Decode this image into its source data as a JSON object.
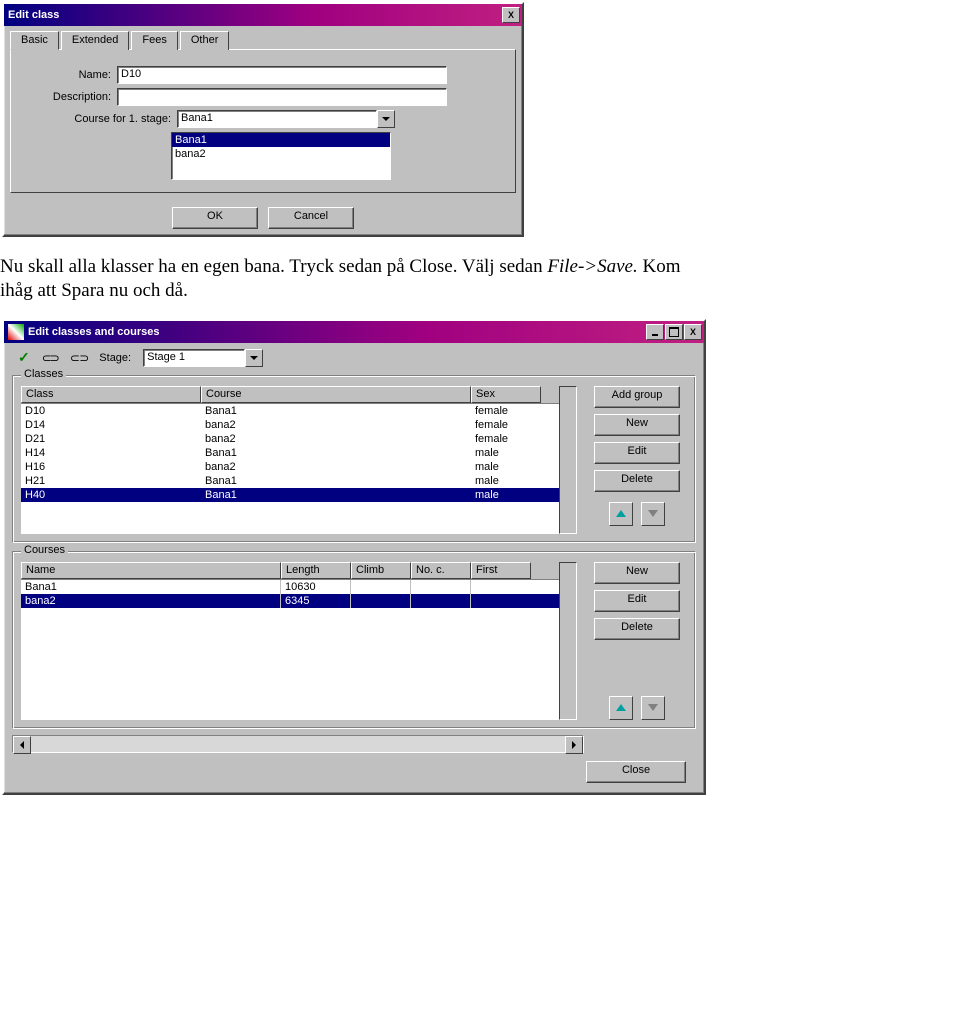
{
  "dialog1": {
    "title": "Edit class",
    "tabs": [
      "Basic",
      "Extended",
      "Fees",
      "Other"
    ],
    "name_label": "Name:",
    "name_value": "D10",
    "desc_label": "Description:",
    "desc_value": "",
    "course_label": "Course for 1. stage:",
    "course_value": "Bana1",
    "course_options": [
      "",
      "Bana1",
      "bana2"
    ],
    "course_selected_index": 1,
    "buttons": {
      "ok": "OK",
      "cancel": "Cancel"
    }
  },
  "paragraph": {
    "pre": "Nu skall alla klasser ha en egen bana. Tryck sedan på Close. Välj sedan ",
    "italic": "File->Save.",
    "post": " Kom ihåg att Spara nu och då."
  },
  "dialog2": {
    "title": "Edit classes and courses",
    "toolbar": {
      "stage_label": "Stage:",
      "stage_value": "Stage 1"
    },
    "classes": {
      "legend": "Classes",
      "headers": [
        "Class",
        "Course",
        "Sex"
      ],
      "rows": [
        {
          "cls": "D10",
          "crs": "Bana1",
          "sex": "female"
        },
        {
          "cls": "D14",
          "crs": "bana2",
          "sex": "female"
        },
        {
          "cls": "D21",
          "crs": "bana2",
          "sex": "female"
        },
        {
          "cls": "H14",
          "crs": "Bana1",
          "sex": "male"
        },
        {
          "cls": "H16",
          "crs": "bana2",
          "sex": "male"
        },
        {
          "cls": "H21",
          "crs": "Bana1",
          "sex": "male"
        },
        {
          "cls": "H40",
          "crs": "Bana1",
          "sex": "male"
        }
      ],
      "selected_index": 6,
      "buttons": {
        "add_group": "Add group",
        "new": "New",
        "edit": "Edit",
        "delete": "Delete"
      }
    },
    "courses": {
      "legend": "Courses",
      "headers": [
        "Name",
        "Length",
        "Climb",
        "No. c.",
        "First"
      ],
      "rows": [
        {
          "name": "Bana1",
          "length": "10630",
          "climb": "",
          "noc": "",
          "first": ""
        },
        {
          "name": "bana2",
          "length": "6345",
          "climb": "",
          "noc": "",
          "first": ""
        }
      ],
      "selected_index": 1,
      "buttons": {
        "new": "New",
        "edit": "Edit",
        "delete": "Delete"
      }
    },
    "close_button": "Close"
  }
}
